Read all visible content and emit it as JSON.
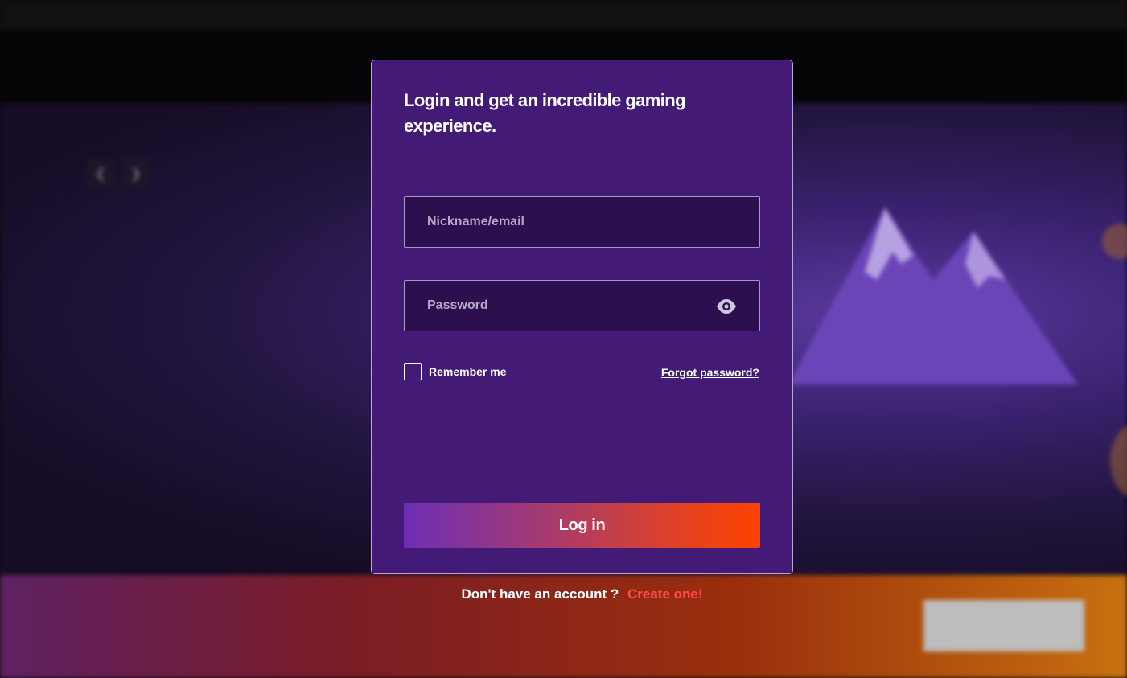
{
  "colors": {
    "modal_background": "#431b76",
    "field_background": "#2c0f4f",
    "login_gradient_start": "#6d2eb5",
    "login_gradient_end": "#ff4200",
    "create_link": "#ff4d4d"
  },
  "modal": {
    "title": "Login and get an incredible gaming experience.",
    "nickname_placeholder": "Nickname/email",
    "password_placeholder": "Password",
    "password_toggle_icon": "eye-icon",
    "remember_label": "Remember me",
    "forgot_label": "Forgot password?",
    "login_button": "Log in"
  },
  "signup": {
    "question": "Don't have an account ?",
    "link": "Create one!"
  }
}
